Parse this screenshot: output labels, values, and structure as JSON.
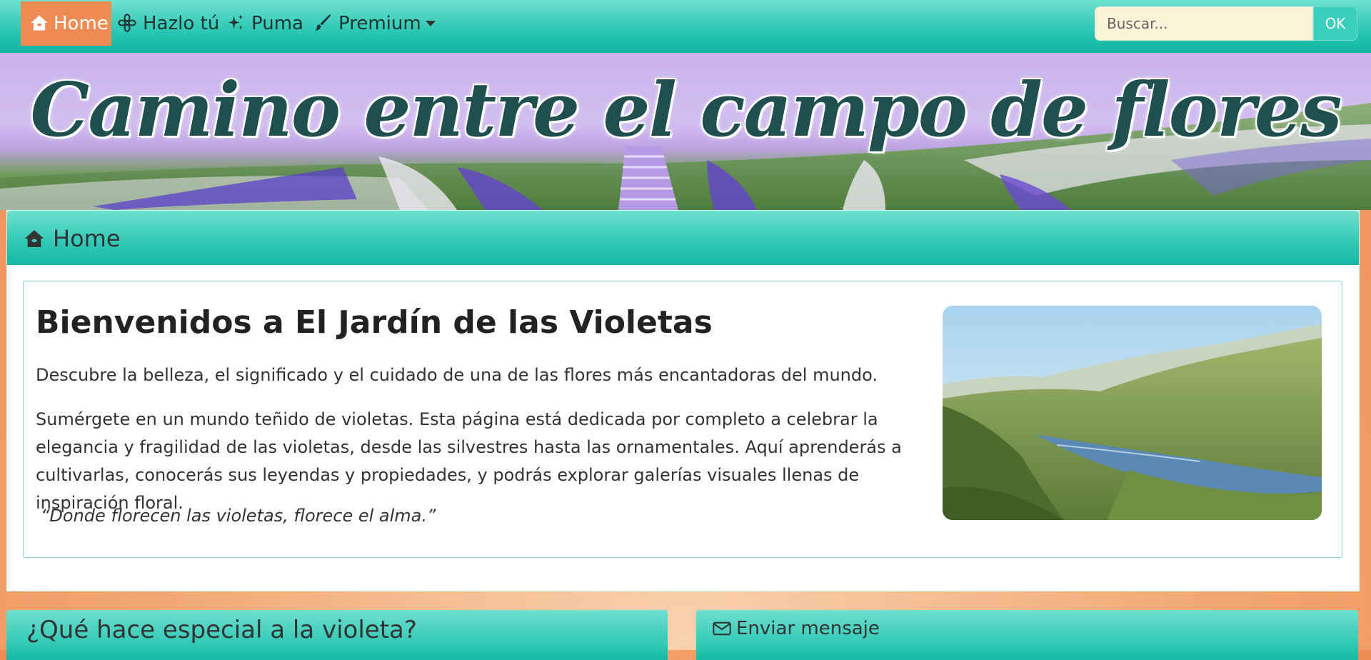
{
  "navbar": {
    "items": [
      {
        "label": "Home",
        "icon": "house-icon",
        "active": true
      },
      {
        "label": "Hazlo tú",
        "icon": "flower-icon"
      },
      {
        "label": "Puma",
        "icon": "sparkles-icon"
      },
      {
        "label": "Premium",
        "icon": "brush-icon",
        "dropdown": true
      }
    ],
    "search": {
      "placeholder": "Buscar...",
      "button_label": "OK"
    }
  },
  "banner": {
    "title": "Camino entre el campo de flores"
  },
  "main_card": {
    "header": "Home",
    "title": "Bienvenidos a El Jardín de las Violetas",
    "intro": "Descubre la belleza, el significado y el cuidado de una de las flores más encantadoras del mundo.",
    "body": "Sumérgete en un mundo teñido de violetas. Esta página está dedicada por completo a celebrar la elegancia y fragilidad de las violetas, desde las silvestres hasta las ornamentales. Aquí aprenderás a cultivarlas, conocerás sus leyendas y propiedades, y podrás explorar galerías visuales llenas de inspiración floral.",
    "quote": "“Donde florecen las violetas, florece el alma.”"
  },
  "bottom_cards": {
    "left_title": "¿Qué hace especial a la violeta?",
    "right_title": "Enviar mensaje"
  },
  "colors": {
    "teal": "#2fc8b5",
    "accent_orange": "#ef8c55",
    "title_dark_teal": "#1f4f4f",
    "search_bg": "#fbf3d8"
  }
}
